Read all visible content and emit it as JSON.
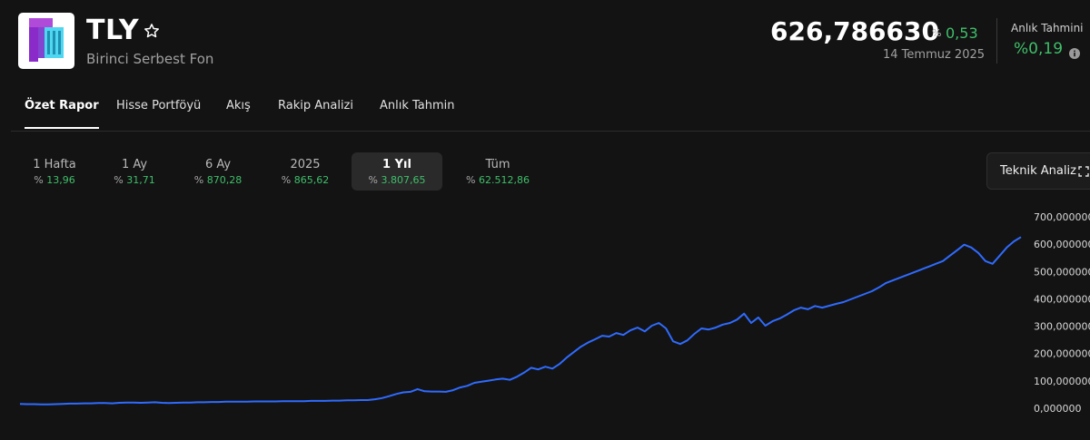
{
  "fund": {
    "ticker": "TLY",
    "name": "Birinci Serbest Fon",
    "price": "626,786630",
    "change_symbol": "%",
    "change": "0,53",
    "date": "14 Temmuz 2025",
    "estimate_label": "Anlık Tahmini",
    "estimate_value": "%0,19"
  },
  "colors": {
    "accent_green": "#3fbf6a",
    "line_blue": "#2f6bff",
    "logo_purple": "#8a2bc9",
    "logo_cyan": "#4fd6f0"
  },
  "icons": [
    "star-icon",
    "info-icon",
    "expand-icon",
    "fund-logo"
  ],
  "tabs": [
    {
      "label": "Özet Rapor",
      "active": true
    },
    {
      "label": "Hisse Portföyü"
    },
    {
      "label": "Akış"
    },
    {
      "label": "Rakip Analizi"
    },
    {
      "label": "Anlık Tahmin"
    }
  ],
  "periods": [
    {
      "label": "1 Hafta",
      "symbol": "%",
      "value": "13,96"
    },
    {
      "label": "1 Ay",
      "symbol": "%",
      "value": "31,71"
    },
    {
      "label": "6 Ay",
      "symbol": "%",
      "value": "870,28"
    },
    {
      "label": "2025",
      "symbol": "%",
      "value": "865,62"
    },
    {
      "label": "1 Yıl",
      "symbol": "%",
      "value": "3.807,65",
      "active": true
    },
    {
      "label": "Tüm",
      "symbol": "%",
      "value": "62.512,86"
    }
  ],
  "tech_button": {
    "label": "Teknik Analiz"
  },
  "chart_data": {
    "type": "line",
    "ylim": [
      0,
      700
    ],
    "y_ticks": [
      "0,000000",
      "100,000000",
      "200,000000",
      "300,000000",
      "400,000000",
      "500,000000",
      "600,000000",
      "700,000000"
    ],
    "grid": false,
    "series": [
      {
        "values": [
          16,
          15,
          15,
          14,
          14,
          15,
          16,
          17,
          17,
          18,
          18,
          19,
          19,
          18,
          20,
          21,
          21,
          20,
          21,
          22,
          20,
          19,
          20,
          21,
          21,
          22,
          22,
          23,
          23,
          24,
          24,
          24,
          24,
          25,
          25,
          25,
          25,
          26,
          26,
          26,
          26,
          27,
          27,
          27,
          28,
          28,
          29,
          29,
          30,
          30,
          33,
          37,
          44,
          52,
          58,
          60,
          70,
          62,
          61,
          61,
          60,
          66,
          76,
          82,
          93,
          97,
          101,
          105,
          108,
          104,
          115,
          130,
          148,
          142,
          152,
          145,
          162,
          185,
          205,
          225,
          240,
          252,
          265,
          262,
          275,
          268,
          285,
          295,
          281,
          302,
          312,
          292,
          245,
          235,
          248,
          272,
          292,
          288,
          295,
          306,
          312,
          324,
          346,
          312,
          332,
          302,
          318,
          328,
          342,
          358,
          368,
          362,
          374,
          368,
          375,
          382,
          388,
          398,
          408,
          418,
          428,
          442,
          458,
          468,
          478,
          488,
          498,
          508,
          518,
          528,
          538,
          558,
          578,
          598,
          588,
          568,
          538,
          528,
          558,
          588,
          610,
          626
        ]
      }
    ]
  }
}
